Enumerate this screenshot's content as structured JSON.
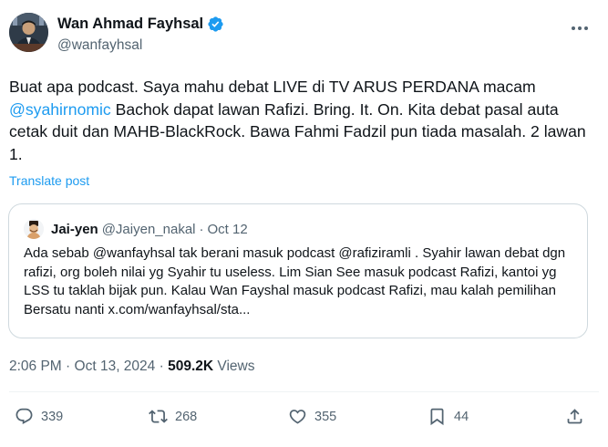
{
  "author": {
    "name": "Wan Ahmad Fayhsal",
    "handle": "@wanfayhsal"
  },
  "tweet": {
    "text_before": "Buat apa podcast. Saya mahu debat LIVE di TV ARUS PERDANA macam ",
    "mention": "@syahirnomic",
    "text_after": " Bachok dapat lawan Rafizi. Bring. It. On. Kita debat pasal auta cetak duit dan MAHB-BlackRock. Bawa Fahmi Fadzil pun tiada masalah. 2 lawan 1.",
    "translate_label": "Translate post"
  },
  "quote": {
    "name": "Jai-yen",
    "handle": "@Jaiyen_nakal",
    "separator": "·",
    "date": "Oct 12",
    "text": "Ada sebab @wanfayhsal tak berani masuk podcast @rafiziramli . Syahir lawan debat dgn rafizi, org boleh nilai yg Syahir tu useless. Lim Sian See masuk podcast Rafizi, kantoi yg LSS tu taklah bijak pun. Kalau Wan Fayshal masuk podcast Rafizi, mau kalah pemilihan Bersatu nanti x.com/wanfayhsal/sta..."
  },
  "meta": {
    "time": "2:06 PM",
    "separator": "·",
    "date": "Oct 13, 2024",
    "separator2": "·",
    "views_count": "509.2K",
    "views_label": "Views"
  },
  "actions": {
    "replies": "339",
    "reposts": "268",
    "likes": "355",
    "bookmarks": "44"
  },
  "icons": {
    "verified": "verified-badge-icon",
    "more": "more-dots-icon",
    "reply": "reply-icon",
    "repost": "repost-icon",
    "like": "heart-icon",
    "bookmark": "bookmark-icon",
    "share": "share-icon"
  },
  "colors": {
    "accent": "#1d9bf0",
    "secondary_text": "#536471",
    "border": "#cfd9de"
  }
}
